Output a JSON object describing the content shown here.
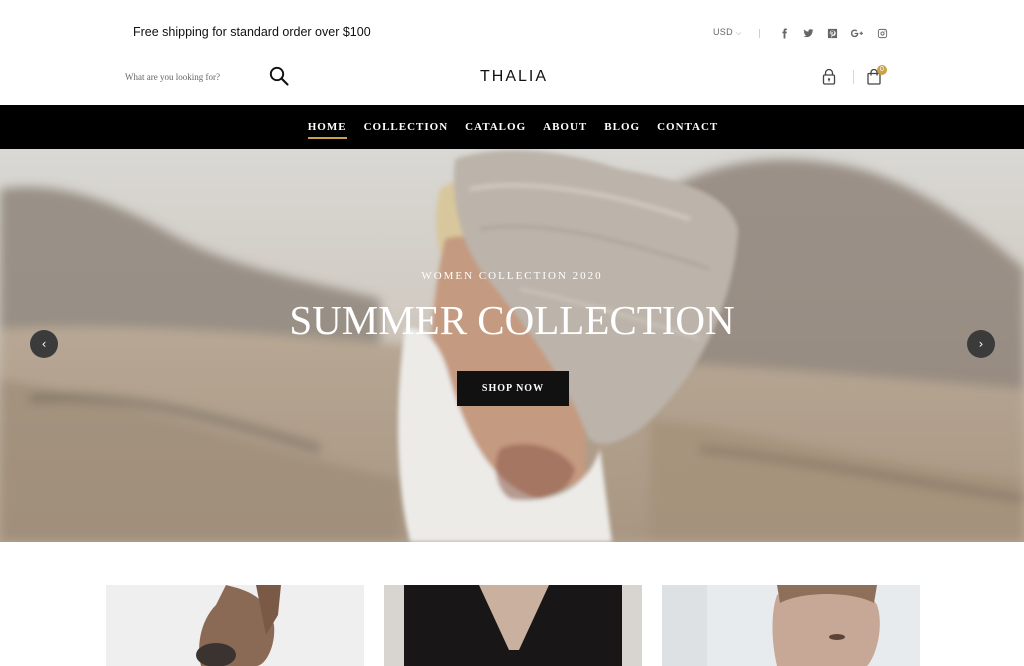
{
  "topbar": {
    "shipping_text": "Free shipping for standard order over $100",
    "currency": "USD",
    "social_icons": [
      "facebook-icon",
      "twitter-icon",
      "pinterest-icon",
      "google-plus-icon",
      "instagram-icon"
    ]
  },
  "header": {
    "search_placeholder": "What are you looking for?",
    "logo": "THALIA",
    "cart_count": "0"
  },
  "nav": {
    "items": [
      {
        "label": "HOME",
        "active": true
      },
      {
        "label": "COLLECTION",
        "active": false
      },
      {
        "label": "CATALOG",
        "active": false
      },
      {
        "label": "ABOUT",
        "active": false
      },
      {
        "label": "BLOG",
        "active": false
      },
      {
        "label": "CONTACT",
        "active": false
      }
    ]
  },
  "hero": {
    "subtitle": "WOMEN COLLECTION 2020",
    "title": "SUMMER COLLECTION",
    "cta_label": "SHOP NOW",
    "prev_glyph": "‹",
    "next_glyph": "›"
  },
  "colors": {
    "accent": "#c9a24a",
    "nav_background": "#000000",
    "button_background": "#111111"
  }
}
